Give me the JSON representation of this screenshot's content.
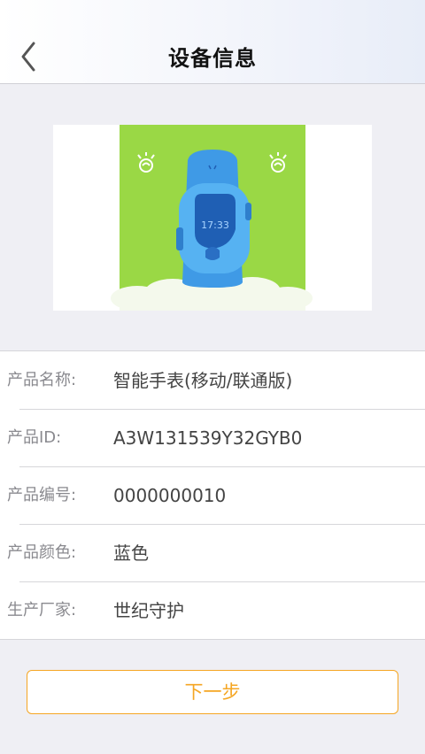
{
  "header": {
    "title": "设备信息"
  },
  "product_image": {
    "watch_time": "17:33"
  },
  "info_rows": [
    {
      "label": "产品名称:",
      "value": "智能手表(移动/联通版)"
    },
    {
      "label": "产品ID:",
      "value": "A3W131539Y32GYB0"
    },
    {
      "label": "产品编号:",
      "value": "0000000010"
    },
    {
      "label": "产品颜色:",
      "value": "蓝色"
    },
    {
      "label": "生产厂家:",
      "value": "世纪守护"
    }
  ],
  "actions": {
    "next_label": "下一步"
  },
  "colors": {
    "accent": "#f5a623",
    "image_background": "#9ad845",
    "watch_body": "#4aa8ee"
  }
}
